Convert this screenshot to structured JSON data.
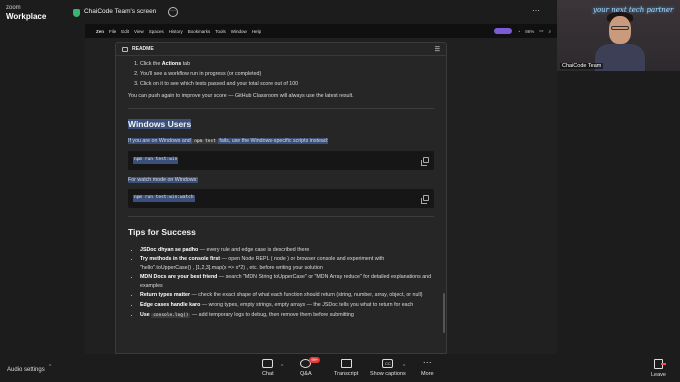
{
  "zoom": {
    "brand_line1": "zoom",
    "brand_line2": "Workplace",
    "share_title": "ChaiCode Team's screen",
    "more_icon": "more-horizontal-icon"
  },
  "mac_menu": {
    "app": "Zen",
    "items": [
      "File",
      "Edit",
      "View",
      "Spaces",
      "History",
      "Bookmarks",
      "Tools",
      "Window",
      "Help"
    ],
    "battery": "86%"
  },
  "readme": {
    "header": "README",
    "steps": [
      {
        "pre": "Click the ",
        "bold": "Actions",
        "post": " tab"
      },
      {
        "pre": "You'll see a workflow run in progress (or completed)",
        "bold": "",
        "post": ""
      },
      {
        "pre": "Click on it to see which tests passed and your total score out of 100",
        "bold": "",
        "post": ""
      }
    ],
    "push_note": "You can push again to improve your score — GitHub Classroom will always use the latest result.",
    "windows_heading": "Windows Users",
    "windows_p_pre": "If you are on Windows and ",
    "windows_p_code": "npm test",
    "windows_p_post": " fails, use the Windows-specific scripts instead:",
    "code1": "npm run test:win",
    "watch_note": "For watch mode on Windows:",
    "code2": "npm run test:win:watch",
    "tips_heading": "Tips for Success",
    "tips": [
      {
        "b": "JSDoc dhyan se padho",
        "t": " — every rule and edge case is described there"
      },
      {
        "b": "Try methods in the console first",
        "t": " — open Node REPL ( node ) or browser console and experiment with \"hello\".toUpperCase() , [1,2,3].map(x => x*2) , etc. before writing your solution"
      },
      {
        "b": "MDN Docs are your best friend",
        "t": " — search \"MDN String toUpperCase\" or \"MDN Array reduce\" for detailed explanations and examples"
      },
      {
        "b": "Return types matter",
        "t": " — check the exact shape of what each function should return (string, number, array, object, or null)"
      },
      {
        "b": "Edge cases handle karo",
        "t": " — wrong types, empty strings, empty arrays — the JSDoc tells you what to return for each"
      },
      {
        "b": "Use ",
        "code": "console.log()",
        "t": " — add temporary logs to debug, then remove them before submitting"
      }
    ]
  },
  "video": {
    "name": "ChaiCode Team",
    "neon_sign": "your next tech partner"
  },
  "toolbar": {
    "audio": "Audio settings",
    "chat": "Chat",
    "qa": "Q&A",
    "qa_badge": "99+",
    "transcript": "Transcript",
    "captions": "Show captions",
    "more": "More",
    "leave": "Leave"
  }
}
